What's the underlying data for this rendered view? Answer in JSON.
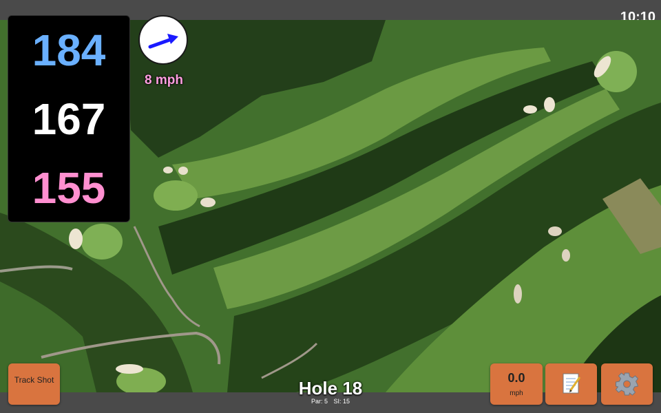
{
  "status": {
    "time": "10:10"
  },
  "distances": {
    "back": "184",
    "middle": "167",
    "front": "155"
  },
  "wind": {
    "speed_text": "8 mph",
    "direction_icon": "wind-arrow-icon"
  },
  "hole": {
    "title": "Hole 18",
    "par": "Par: 5",
    "si": "SI: 15"
  },
  "buttons": {
    "track_shot": "Track Shot",
    "wind_value": "0.0",
    "wind_unit": "mph",
    "notes_icon": "notepad-icon",
    "settings_icon": "gear-icon"
  },
  "colors": {
    "back_distance": "#6ab0ff",
    "middle_distance": "#ffffff",
    "front_distance": "#ff8fd0",
    "button": "#d9743f",
    "wind_arrow": "#1a1aff"
  }
}
